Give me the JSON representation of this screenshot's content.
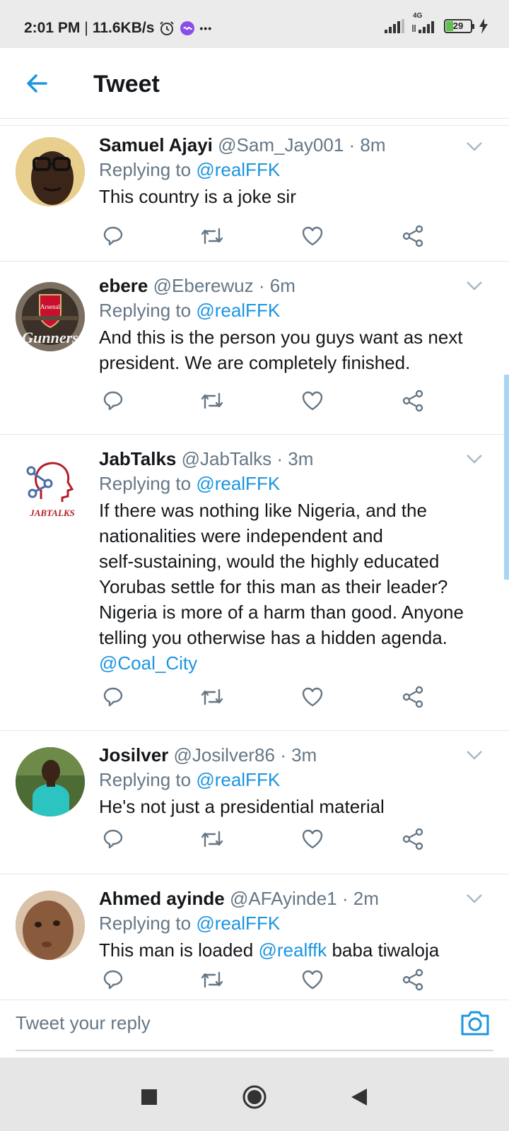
{
  "status_bar": {
    "time": "2:01 PM",
    "separator": "|",
    "speed": "11.6KB/s",
    "more": "•••",
    "network_label": "4G",
    "battery": "29",
    "battery_level": 0.29
  },
  "header": {
    "title": "Tweet"
  },
  "tweets": [
    {
      "name": "Samuel Ajayi",
      "handle": "@Sam_Jay001",
      "time": "· 8m",
      "replying_prefix": "Replying to",
      "replying_to": "@realFFK",
      "lines": [
        "This country is a joke sir"
      ]
    },
    {
      "name": "ebere",
      "handle": "@Eberewuz",
      "time": "· 6m",
      "replying_prefix": "Replying to",
      "replying_to": "@realFFK",
      "lines": [
        "And this is the person you guys want as next",
        "president. We are completely finished."
      ],
      "avatar_text_top": "Arsenal",
      "avatar_text_bottom": "Gunners"
    },
    {
      "name": "JabTalks",
      "handle": "@JabTalks",
      "time": "· 3m",
      "replying_prefix": "Replying to",
      "replying_to": "@realFFK",
      "lines": [
        "If there was nothing like Nigeria, and the",
        "nationalities were independent and",
        "self-sustaining, would the highly educated",
        "Yorubas settle for this man as their leader?",
        "Nigeria is more of a harm than good. Anyone",
        "telling you otherwise has a hidden agenda."
      ],
      "trailing_mention": "@Coal_City",
      "avatar_text": "JABTALKS"
    },
    {
      "name": "Josilver",
      "handle": "@Josilver86",
      "time": "· 3m",
      "replying_prefix": "Replying to",
      "replying_to": "@realFFK",
      "lines": [
        "He's not just a presidential material"
      ]
    },
    {
      "name": "Ahmed ayinde",
      "handle": "@AFAyinde1",
      "time": "· 2m",
      "replying_prefix": "Replying to",
      "replying_to": "@realFFK",
      "text_before": "This man is loaded",
      "inline_mention": "@realffk",
      "text_after": "baba tiwaloja"
    }
  ],
  "reply_bar": {
    "placeholder": "Tweet your reply"
  },
  "icons": {
    "back": "arrow-left-icon",
    "reply": "reply-icon",
    "retweet": "retweet-icon",
    "like": "heart-icon",
    "share": "share-icon",
    "caret": "chevron-down-icon",
    "camera": "camera-icon"
  },
  "colors": {
    "accent": "#1b95e0",
    "text_primary": "#14171a",
    "text_secondary": "#657786",
    "divider": "#e1e8ed"
  }
}
